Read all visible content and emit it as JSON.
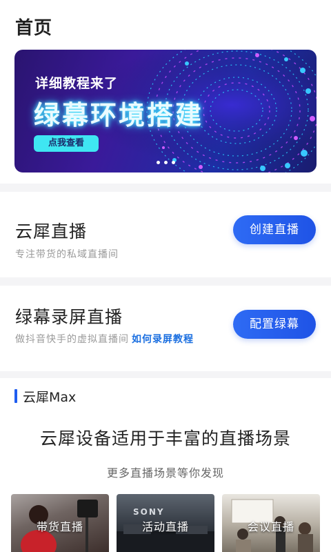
{
  "header": {
    "title": "首页"
  },
  "banner": {
    "subtitle": "详细教程来了",
    "title": "绿幕环境搭建",
    "button": "点我查看",
    "dots": 3
  },
  "cards": [
    {
      "title": "云犀直播",
      "subtitle": "专注带货的私域直播间",
      "link": "",
      "button": "创建直播"
    },
    {
      "title": "绿幕录屏直播",
      "subtitle": "做抖音快手的虚拟直播间",
      "link": "如何录屏教程",
      "button": "配置绿幕"
    }
  ],
  "section": {
    "label": "云犀Max"
  },
  "promo": {
    "title": "云犀设备适用于丰富的直播场景",
    "subtitle": "更多直播场景等你发现"
  },
  "scenes": [
    {
      "label": "带货直播"
    },
    {
      "label": "活动直播"
    },
    {
      "label": "会议直播"
    }
  ],
  "colors": {
    "accent": "#1f5df0",
    "banner_cta": "#3fe6f2",
    "link": "#1b6fe0"
  }
}
